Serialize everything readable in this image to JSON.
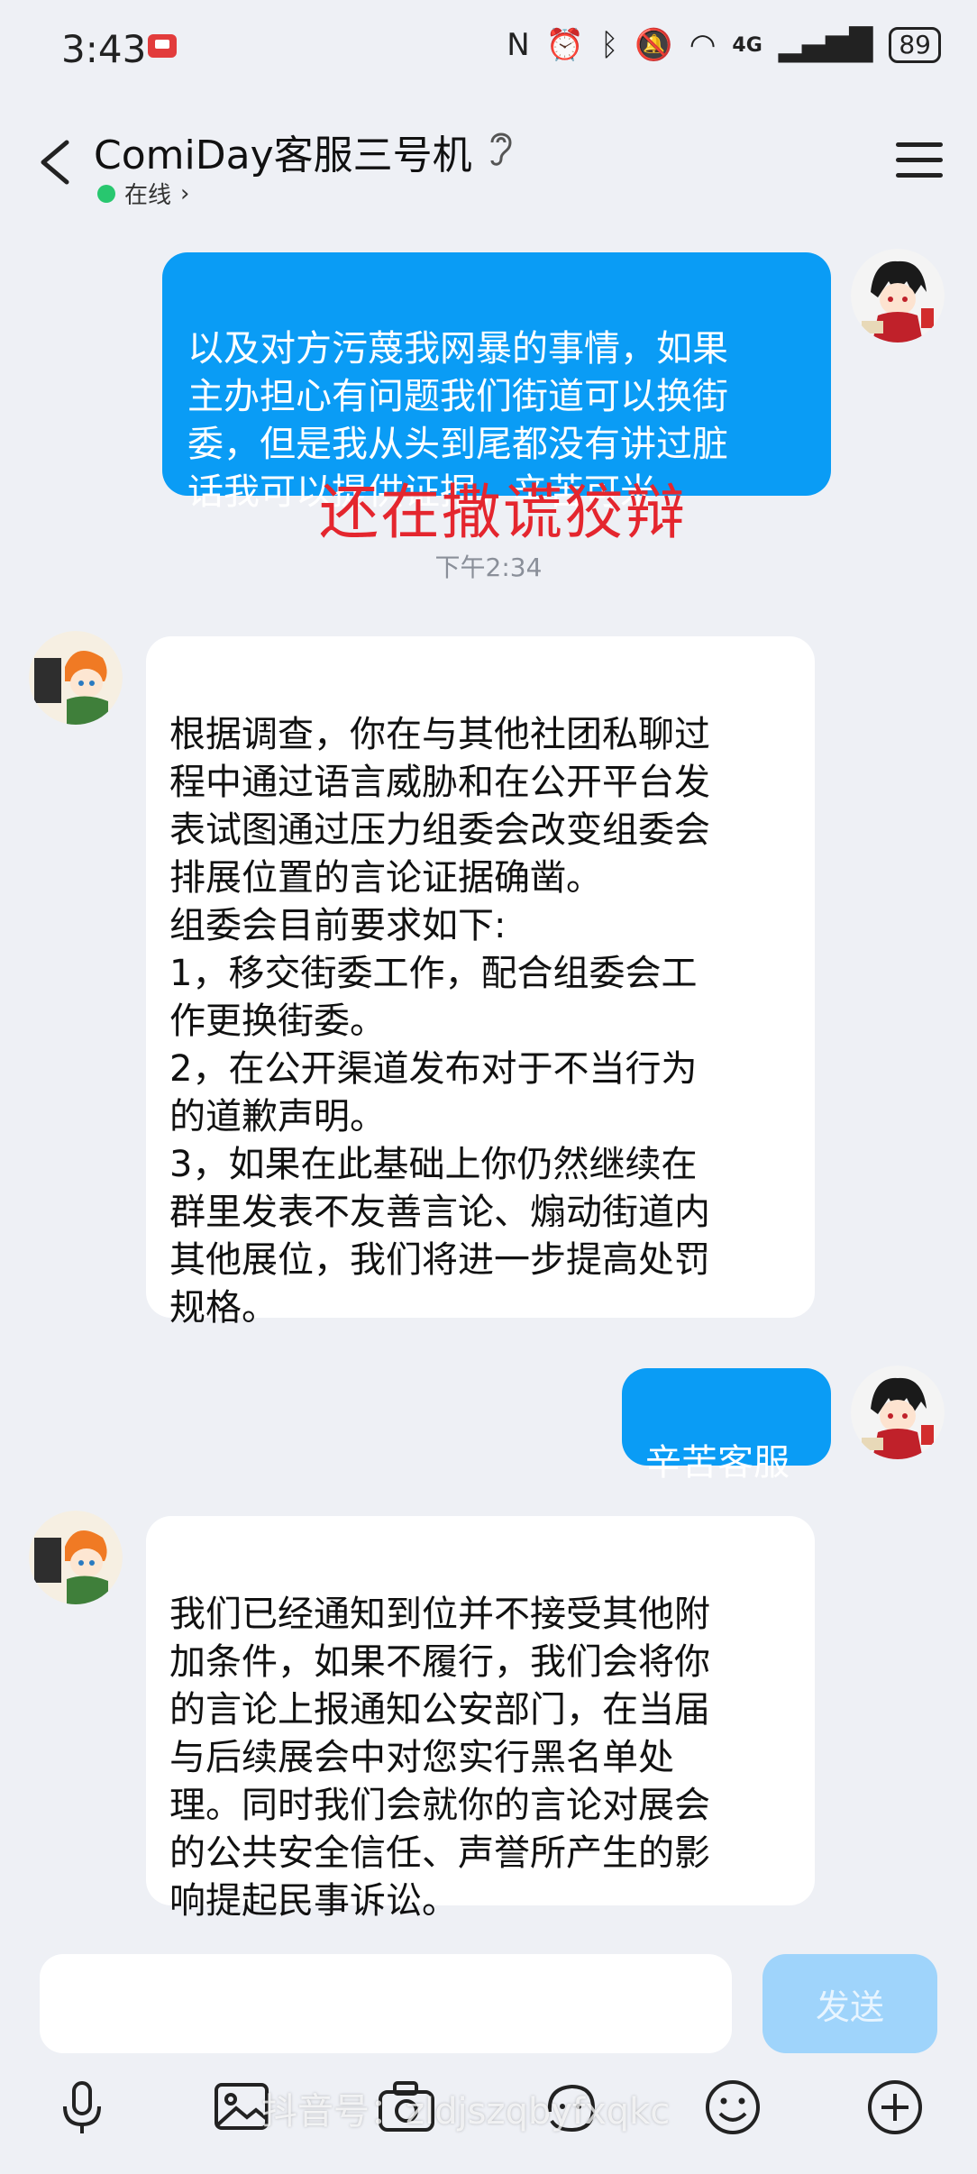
{
  "status": {
    "time": "3:43",
    "network": "4G",
    "battery": "89"
  },
  "header": {
    "title": "ComiDay客服三号机",
    "presence": "在线",
    "presence_chevron": "›"
  },
  "messages": [
    {
      "from": "me",
      "text": "以及对方污蔑我网暴的事情，如果\n主办担心有问题我们街道可以换街\n委，但是我从头到尾都没有讲过脏\n话我可以提供证据，辛苦可米"
    },
    {
      "from": "overlay",
      "text": "还在撒谎狡辩"
    },
    {
      "from": "time",
      "text": "下午2:34"
    },
    {
      "from": "service",
      "text": "根据调查，你在与其他社团私聊过\n程中通过语言威胁和在公开平台发\n表试图通过压力组委会改变组委会\n排展位置的言论证据确凿。\n组委会目前要求如下:\n1，移交街委工作，配合组委会工\n作更换街委。\n2，在公开渠道发布对于不当行为\n的道歉声明。\n3，如果在此基础上你仍然继续在\n群里发表不友善言论、煽动街道内\n其他展位，我们将进一步提高处罚\n规格。"
    },
    {
      "from": "me",
      "text": "辛苦客服"
    },
    {
      "from": "service",
      "text": "我们已经通知到位并不接受其他附\n加条件，如果不履行，我们会将你\n的言论上报通知公安部门，在当届\n与后续展会中对您实行黑名单处\n理。同时我们会就你的言论对展会\n的公共安全信任、声誉所产生的影\n响提起民事诉讼。"
    }
  ],
  "composer": {
    "input_value": "",
    "send_label": "发送"
  },
  "toolbar": [
    "microphone-icon",
    "image-icon",
    "camera-icon",
    "emoji-icon",
    "plus-icon"
  ],
  "watermark": "抖音号：zldjszqbyfxqkc"
}
